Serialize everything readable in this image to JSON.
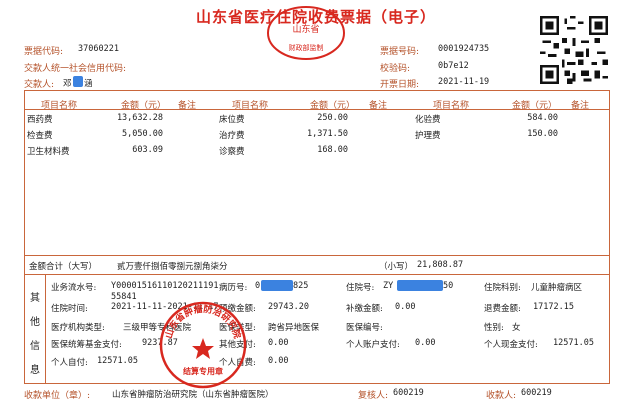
{
  "title": "山东省医疗住院收费票据（电子）",
  "header_left": {
    "code_label": "票据代码:",
    "code_value": "37060221",
    "credit_label": "交款人统一社会信用代码:",
    "payer_label": "交款人:",
    "payer_value_a": "邓",
    "payer_value_b": "涵"
  },
  "header_right": {
    "number_label": "票据号码:",
    "number_value": "0001924735",
    "check_label": "校验码:",
    "check_value": "0b7e12",
    "date_label": "开票日期:",
    "date_value": "2021-11-19"
  },
  "seal_top": {
    "line1": "山东省",
    "line2": "财政部监制"
  },
  "table": {
    "headers": [
      "项目名称",
      "金额（元）",
      "备注",
      "项目名称",
      "金额（元）",
      "备注",
      "项目名称",
      "金额（元）",
      "备注"
    ],
    "col1": [
      {
        "name": "西药费",
        "amount": "13,632.28"
      },
      {
        "name": "检查费",
        "amount": "5,050.00"
      },
      {
        "name": "卫生材料费",
        "amount": "603.09"
      }
    ],
    "col2": [
      {
        "name": "床位费",
        "amount": "250.00"
      },
      {
        "name": "治疗费",
        "amount": "1,371.50"
      },
      {
        "name": "诊察费",
        "amount": "168.00"
      }
    ],
    "col3": [
      {
        "name": "化验费",
        "amount": "584.00"
      },
      {
        "name": "护理费",
        "amount": "150.00"
      }
    ]
  },
  "total": {
    "label": "金额合计（大写）",
    "upper": "贰万壹仟捌佰零捌元捌角柒分",
    "small_label": "（小写）",
    "small_value": "21,808.87"
  },
  "other": {
    "side_label": [
      "其",
      "他",
      "信",
      "息"
    ],
    "serial_label": "业务流水号:",
    "serial_value_a": "Y00001516110120211191",
    "serial_value_b": "55841",
    "case_label": "病历号:",
    "case_value_a": "0",
    "case_value_b": "825",
    "hosp_label": "住院号:",
    "hosp_value_a": "ZY",
    "hosp_value_b": "50",
    "dept_label": "住院科别:",
    "dept_value": "儿童肿瘤病区",
    "period_label": "住院时间:",
    "period_value": "2021-11-11-2021-11-17",
    "prepay_label": "预缴金额:",
    "prepay_value": "29743.20",
    "supp_label": "补缴金额:",
    "supp_value": "0.00",
    "refund_label": "退费金额:",
    "refund_value": "17172.15",
    "org_label": "医疗机构类型:",
    "org_value": "三级甲等专科医院",
    "ins_type_label": "医保类型:",
    "ins_type_value": "跨省异地医保",
    "ins_no_label": "医保编号:",
    "gender_label": "性别:",
    "gender_value": "女",
    "fund_label": "医保统筹基金支付:",
    "fund_value": "9237.87",
    "other_pay_label": "其他支付:",
    "other_pay_value": "0.00",
    "acct_label": "个人账户支付:",
    "acct_value": "0.00",
    "cash_label": "个人现金支付:",
    "cash_value": "12571.05",
    "self_label": "个人自付:",
    "self_value": "12571.05",
    "selfpay_label": "个人自费:",
    "selfpay_value": "0.00"
  },
  "seal_bottom": {
    "ring": "山东省肿瘤防治研究院",
    "band": "结算专用章"
  },
  "footer": {
    "unit_label": "收款单位（章）:",
    "unit_value": "山东省肿瘤防治研究院（山东省肿瘤医院）",
    "checker_label": "复核人:",
    "checker_value": "600219",
    "payee_label": "收款人:",
    "payee_value": "600219"
  }
}
